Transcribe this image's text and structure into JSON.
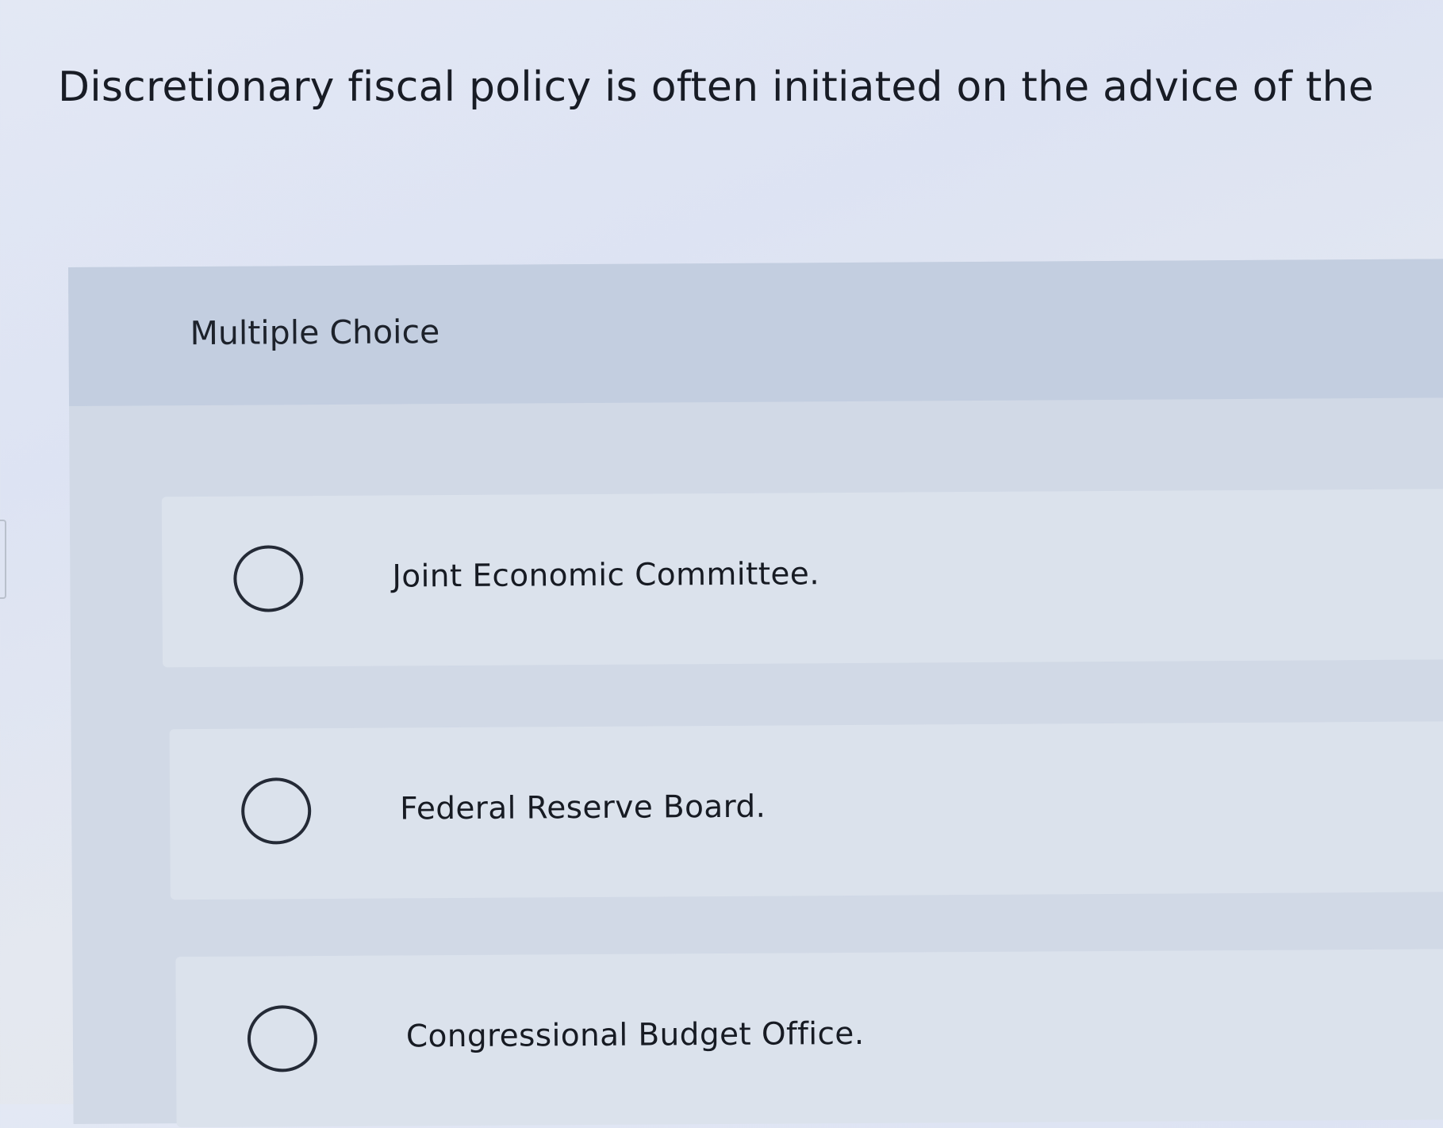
{
  "question": {
    "text": "Discretionary fiscal policy is often initiated on the advice of the"
  },
  "answer_panel": {
    "header_label": "Multiple Choice",
    "options": [
      {
        "label": "Joint Economic Committee.",
        "selected": false
      },
      {
        "label": "Federal Reserve Board.",
        "selected": false
      },
      {
        "label": "Congressional Budget Office.",
        "selected": false
      }
    ]
  },
  "colors": {
    "page_background": "#e3e8f4",
    "panel_background": "#d1d9e6",
    "panel_header_background": "#c3cee0",
    "option_background": "#dbe2ec",
    "text": "#181c25",
    "radio_border": "#242a36"
  }
}
